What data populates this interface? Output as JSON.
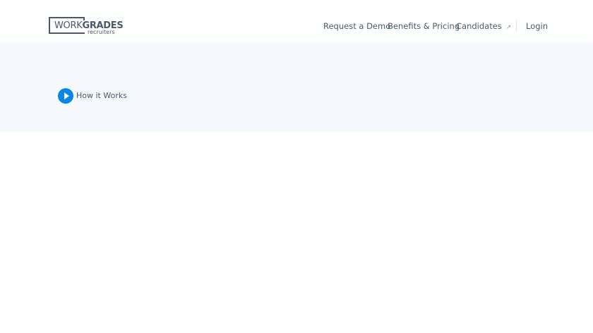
{
  "logo": {
    "word_light": "WORK",
    "word_bold": "GRADES",
    "sub": "recruiters"
  },
  "nav": {
    "demo": "Request a Demo",
    "pricing": "Benefits & Pricing",
    "candidates": "Candidates",
    "login": "Login"
  },
  "hero": {
    "how_it_works": "How it Works"
  }
}
